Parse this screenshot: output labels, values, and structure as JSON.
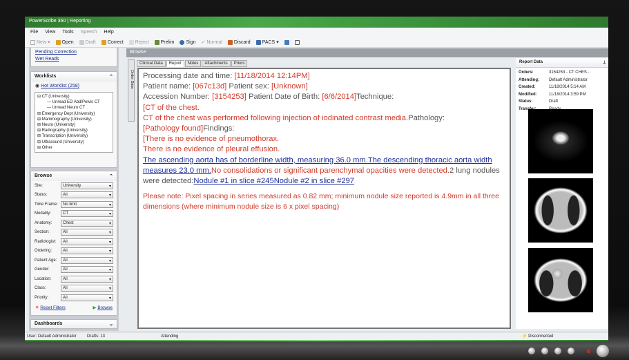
{
  "window": {
    "title": "PowerScribe 360 | Reporting"
  },
  "menu": [
    "File",
    "View",
    "Tools",
    "Speech",
    "Help"
  ],
  "toolbar": [
    {
      "label": "New",
      "disabled": true
    },
    {
      "label": "Open"
    },
    {
      "label": "Draft",
      "disabled": true
    },
    {
      "label": "Correct"
    },
    {
      "label": "Reject",
      "disabled": true
    },
    {
      "label": "Prelim"
    },
    {
      "label": "Sign"
    },
    {
      "label": "Normal",
      "disabled": true
    },
    {
      "label": "Discard"
    },
    {
      "label": "PACS"
    }
  ],
  "left": {
    "quick_links": [
      "Pending Correction",
      "Wet Reads"
    ],
    "worklists": {
      "title": "Worklists",
      "hot": "Hot Worklist (258)",
      "tree": [
        "CT (University)",
        "Unread ED Abd/Pelvis CT",
        "Unread Neuro CT",
        "Emergency Dept (University)",
        "Mammography (University)",
        "Neuro (University)",
        "Radiography (University)",
        "Transcription (University)",
        "Ultrasound (University)",
        "Other"
      ]
    },
    "browse": {
      "title": "Browse",
      "filters": [
        {
          "label": "Site:",
          "value": "University"
        },
        {
          "label": "Status:",
          "value": "All"
        },
        {
          "label": "Time Frame:",
          "value": "No limit"
        },
        {
          "label": "Modality:",
          "value": "CT"
        },
        {
          "label": "Anatomy:",
          "value": "Chest"
        },
        {
          "label": "Section:",
          "value": "All"
        },
        {
          "label": "Radiologist:",
          "value": "All"
        },
        {
          "label": "Ordering:",
          "value": "All"
        },
        {
          "label": "Patient Age:",
          "value": "All"
        },
        {
          "label": "Gender:",
          "value": "All"
        },
        {
          "label": "Location:",
          "value": "All"
        },
        {
          "label": "Class:",
          "value": "All"
        },
        {
          "label": "Priority:",
          "value": "All"
        }
      ],
      "reset": "Reset Filters",
      "browse": "Browse"
    },
    "dashboards": "Dashboards"
  },
  "main": {
    "header": "Browse",
    "side_tab": "Order Data",
    "tabs": [
      "Clinical Data",
      "Report",
      "Notes",
      "Attachments",
      "Priors"
    ],
    "report": {
      "l1a": "Processing date and time: ",
      "l1b": "[11/18/2014 12:14PM]",
      "l2a": "Patient name: ",
      "l2b": "[067c13d]",
      "l2c": " Patient sex: ",
      "l2d": "[Unknown]",
      "l3a": "Accession Number: ",
      "l3b": "[3154253]",
      "l3c": " Patient Date of Birth: ",
      "l3d": "[6/6/2014]",
      "l3e": "Technique:",
      "l4": "[CT of the chest.",
      "l5a": "CT of the chest was performed following injection of iodinated contrast media.",
      "l5b": "Pathology:",
      "l6a": "[Pathology found]",
      "l6b": "Findings:",
      "l7": "[There is no evidence of pneumothorax.",
      "l8": "There is no evidence of pleural effusion.",
      "l9a": "The ascending aorta has of borderline width, measuring 36.0 mm.",
      "l9b": "The descending thoracic aorta width measures 23.0 mm.",
      "l9c": "No consolidations or significant parenchymal opacities were detected.",
      "l9d": "2 lung nodules were detected:",
      "n1": "Nodule #1 in slice #245",
      "n2": "Nodule #2 in slice #297",
      "note": "Please note: Pixel spacing in series measured as 0.82 mm; minimum nodule size reported is 4.9mm in all three dimensions (where minimum nodule size is 6 x pixel spacing)"
    }
  },
  "report_data": {
    "title": "Report Data",
    "fields": [
      {
        "k": "Orders:",
        "v": "3154253 - CT CHES..."
      },
      {
        "k": "Attending:",
        "v": "Default Administrator"
      },
      {
        "k": "Created:",
        "v": "11/18/2014 5:14 AM"
      },
      {
        "k": "Modified:",
        "v": "11/18/2014 3:59 PM"
      },
      {
        "k": "Status:",
        "v": "Draft"
      },
      {
        "k": "Transfer:",
        "v": "Ready"
      }
    ]
  },
  "status": {
    "user": "User: Default Administrator",
    "drafts": "Drafts: 13",
    "role": "Attending",
    "connection": "Disconnected"
  }
}
